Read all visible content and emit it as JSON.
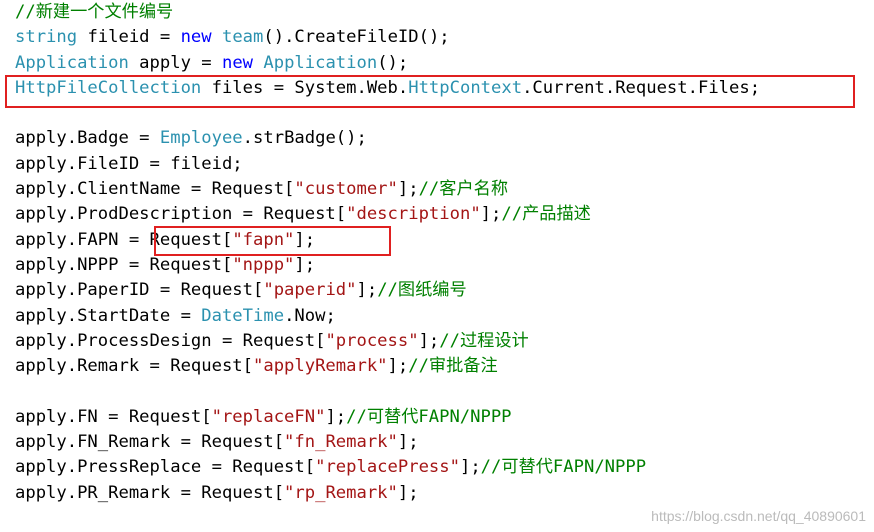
{
  "colors": {
    "comment": "#008000",
    "keyword": "#0000ff",
    "type": "#2b91af",
    "string": "#a31515",
    "text": "#000000",
    "highlight_border": "#e02020"
  },
  "code_lines": [
    [
      [
        "comment",
        "//新建一个文件编号"
      ]
    ],
    [
      [
        "type",
        "string"
      ],
      [
        "text",
        " fileid = "
      ],
      [
        "keyword",
        "new"
      ],
      [
        "text",
        " "
      ],
      [
        "type",
        "team"
      ],
      [
        "text",
        "().CreateFileID();"
      ]
    ],
    [
      [
        "type",
        "Application"
      ],
      [
        "text",
        " apply = "
      ],
      [
        "keyword",
        "new"
      ],
      [
        "text",
        " "
      ],
      [
        "type",
        "Application"
      ],
      [
        "text",
        "();"
      ]
    ],
    [
      [
        "type",
        "HttpFileCollection"
      ],
      [
        "text",
        " files = System.Web."
      ],
      [
        "type",
        "HttpContext"
      ],
      [
        "text",
        ".Current.Request.Files;"
      ]
    ],
    [],
    [
      [
        "text",
        "apply.Badge = "
      ],
      [
        "type",
        "Employee"
      ],
      [
        "text",
        ".strBadge();"
      ]
    ],
    [
      [
        "text",
        "apply.FileID = fileid;"
      ]
    ],
    [
      [
        "text",
        "apply.ClientName = Request["
      ],
      [
        "string",
        "\"customer\""
      ],
      [
        "text",
        "];"
      ],
      [
        "comment",
        "//客户名称"
      ]
    ],
    [
      [
        "text",
        "apply.ProdDescription = Request["
      ],
      [
        "string",
        "\"description\""
      ],
      [
        "text",
        "];"
      ],
      [
        "comment",
        "//产品描述"
      ]
    ],
    [
      [
        "text",
        "apply.FAPN = Request["
      ],
      [
        "string",
        "\"fapn\""
      ],
      [
        "text",
        "];"
      ]
    ],
    [
      [
        "text",
        "apply.NPPP = Request["
      ],
      [
        "string",
        "\"nppp\""
      ],
      [
        "text",
        "];"
      ]
    ],
    [
      [
        "text",
        "apply.PaperID = Request["
      ],
      [
        "string",
        "\"paperid\""
      ],
      [
        "text",
        "];"
      ],
      [
        "comment",
        "//图纸编号"
      ]
    ],
    [
      [
        "text",
        "apply.StartDate = "
      ],
      [
        "type",
        "DateTime"
      ],
      [
        "text",
        ".Now;"
      ]
    ],
    [
      [
        "text",
        "apply.ProcessDesign = Request["
      ],
      [
        "string",
        "\"process\""
      ],
      [
        "text",
        "];"
      ],
      [
        "comment",
        "//过程设计"
      ]
    ],
    [
      [
        "text",
        "apply.Remark = Request["
      ],
      [
        "string",
        "\"applyRemark\""
      ],
      [
        "text",
        "];"
      ],
      [
        "comment",
        "//审批备注"
      ]
    ],
    [],
    [
      [
        "text",
        "apply.FN = Request["
      ],
      [
        "string",
        "\"replaceFN\""
      ],
      [
        "text",
        "];"
      ],
      [
        "comment",
        "//可替代FAPN/NPPP"
      ]
    ],
    [
      [
        "text",
        "apply.FN_Remark = Request["
      ],
      [
        "string",
        "\"fn_Remark\""
      ],
      [
        "text",
        "];"
      ]
    ],
    [
      [
        "text",
        "apply.PressReplace = Request["
      ],
      [
        "string",
        "\"replacePress\""
      ],
      [
        "text",
        "];"
      ],
      [
        "comment",
        "//可替代FAPN/NPPP"
      ]
    ],
    [
      [
        "text",
        "apply.PR_Remark = Request["
      ],
      [
        "string",
        "\"rp_Remark\""
      ],
      [
        "text",
        "];"
      ]
    ]
  ],
  "watermark": "https://blog.csdn.net/qq_40890601"
}
